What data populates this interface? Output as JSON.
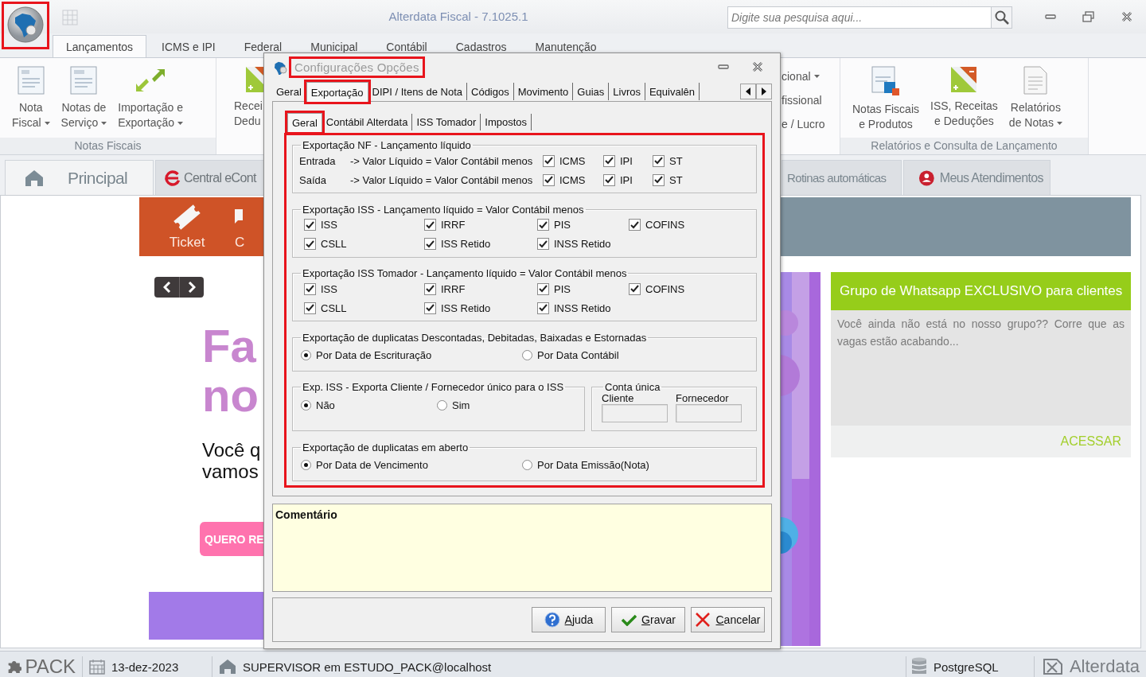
{
  "app": {
    "title": "Alterdata Fiscal - 7.1025.1",
    "logo_highlighted": true
  },
  "search": {
    "placeholder": "Digite sua pesquisa aqui..."
  },
  "ribbon_tabs": [
    {
      "label": "Lançamentos",
      "selected": true
    },
    {
      "label": "ICMS e IPI",
      "selected": false
    },
    {
      "label": "Federal",
      "selected": false
    },
    {
      "label": "Municipal",
      "selected": false
    },
    {
      "label": "Contábil",
      "selected": false
    },
    {
      "label": "Cadastros",
      "selected": false
    },
    {
      "label": "Manutenção",
      "selected": false
    }
  ],
  "ribbon_groups": [
    {
      "kind": "buttons",
      "title": "Notas Fiscais",
      "buttons": [
        {
          "lines": [
            "Nota",
            "Fiscal"
          ],
          "dropdown": true
        },
        {
          "lines": [
            "Notas de",
            "Serviço"
          ],
          "dropdown": true
        },
        {
          "lines": [
            "Importação e",
            "Exportação"
          ],
          "dropdown": true
        }
      ]
    },
    {
      "kind": "partial",
      "buttons": [
        {
          "lines": [
            "Recei",
            "Dedu"
          ]
        }
      ]
    },
    {
      "kind": "list",
      "items": [
        {
          "label": "cional",
          "dropdown": true
        },
        {
          "label": "fissional",
          "dropdown": false
        },
        {
          "label": "e / Lucro",
          "dropdown": false
        }
      ]
    },
    {
      "kind": "buttons",
      "title": "Relatórios e Consulta de Lançamento",
      "buttons": [
        {
          "lines": [
            "Notas Fiscais",
            "e Produtos"
          ],
          "dropdown": false
        },
        {
          "lines": [
            "ISS, Receitas",
            "e Deduções"
          ],
          "dropdown": false
        },
        {
          "lines": [
            "Relatórios",
            "de Notas"
          ],
          "dropdown": true
        }
      ]
    }
  ],
  "doc_tabs": [
    {
      "label": "Principal",
      "selected": true
    },
    {
      "label": "Central eCont",
      "selected": false
    },
    {
      "label": "Rotinas automáticas",
      "selected": false
    },
    {
      "label": "Meus Atendimentos",
      "selected": false
    }
  ],
  "web": {
    "shortcuts": [
      {
        "label": "Ticket"
      },
      {
        "label": "C"
      }
    ],
    "headline": [
      "Fa",
      "no"
    ],
    "subtext": [
      "Você q",
      "vamos"
    ],
    "cta": "QUERO RE",
    "card": {
      "title": "Grupo de Whatsapp EXCLUSIVO para clientes",
      "body": "Você ainda não está no nosso grupo?? Corre que as vagas estão acabando...",
      "link": "ACESSAR"
    }
  },
  "dialog": {
    "title": "Configurações Opções",
    "title_highlighted": true,
    "tabs": [
      {
        "label": "Geral",
        "selected": false,
        "highlighted": false
      },
      {
        "label": "Exportação",
        "selected": true,
        "highlighted": true
      },
      {
        "label": "DIPI / Itens de Nota",
        "selected": false,
        "highlighted": false
      },
      {
        "label": "Códigos",
        "selected": false,
        "highlighted": false
      },
      {
        "label": "Movimento",
        "selected": false,
        "highlighted": false
      },
      {
        "label": "Guias",
        "selected": false,
        "highlighted": false
      },
      {
        "label": "Livros",
        "selected": false,
        "highlighted": false
      },
      {
        "label": "Equivalên",
        "selected": false,
        "highlighted": false
      }
    ],
    "subtabs": [
      {
        "label": "Geral",
        "selected": true,
        "highlighted": true
      },
      {
        "label": "Contábil Alterdata",
        "selected": false,
        "highlighted": false
      },
      {
        "label": "ISS Tomador",
        "selected": false,
        "highlighted": false
      },
      {
        "label": "Impostos",
        "selected": false,
        "highlighted": false
      }
    ],
    "options_highlighted": true,
    "groups": [
      {
        "kind": "nf",
        "title": "Exportação NF - Lançamento líquido",
        "rows": [
          {
            "label": "Entrada",
            "formula": "-> Valor Líquido = Valor Contábil menos",
            "checks": [
              {
                "label": "ICMS",
                "checked": true
              },
              {
                "label": "IPI",
                "checked": true
              },
              {
                "label": "ST",
                "checked": true
              }
            ]
          },
          {
            "label": "Saída",
            "formula": "-> Valor Líquido = Valor Contábil menos",
            "checks": [
              {
                "label": "ICMS",
                "checked": true
              },
              {
                "label": "IPI",
                "checked": true
              },
              {
                "label": "ST",
                "checked": true
              }
            ]
          }
        ]
      },
      {
        "kind": "checks",
        "title": "Exportação ISS - Lançamento líquido = Valor Contábil menos",
        "checks": [
          {
            "label": "ISS",
            "checked": true
          },
          {
            "label": "IRRF",
            "checked": true
          },
          {
            "label": "PIS",
            "checked": true
          },
          {
            "label": "COFINS",
            "checked": true
          },
          {
            "label": "CSLL",
            "checked": true
          },
          {
            "label": "ISS Retido",
            "checked": true
          },
          {
            "label": "INSS Retido",
            "checked": true
          }
        ]
      },
      {
        "kind": "checks",
        "title": "Exportação ISS Tomador - Lançamento líquido = Valor Contábil menos",
        "checks": [
          {
            "label": "ISS",
            "checked": true
          },
          {
            "label": "IRRF",
            "checked": true
          },
          {
            "label": "PIS",
            "checked": true
          },
          {
            "label": "COFINS",
            "checked": true
          },
          {
            "label": "CSLL",
            "checked": true
          },
          {
            "label": "ISS Retido",
            "checked": true
          },
          {
            "label": "INSS Retido",
            "checked": true
          }
        ]
      },
      {
        "kind": "radios",
        "title": "Exportação de duplicatas Descontadas, Debitadas, Baixadas e Estornadas",
        "options": [
          {
            "label": "Por Data de Escrituração",
            "selected": true
          },
          {
            "label": "Por Data Contábil",
            "selected": false
          }
        ]
      },
      {
        "kind": "radios_split",
        "title": "Exp. ISS - Exporta Cliente / Fornecedor único para o ISS",
        "options": [
          {
            "label": "Não",
            "selected": true
          },
          {
            "label": "Sim",
            "selected": false
          }
        ],
        "side": {
          "title": "Conta única",
          "fields": [
            {
              "label": "Cliente"
            },
            {
              "label": "Fornecedor"
            }
          ]
        }
      },
      {
        "kind": "radios",
        "title": "Exportação de duplicatas em aberto",
        "options": [
          {
            "label": "Por Data de Vencimento",
            "selected": true
          },
          {
            "label": "Por Data Emissão(Nota)",
            "selected": false
          }
        ]
      }
    ],
    "comment_label": "Comentário",
    "buttons": [
      {
        "label": "Ajuda"
      },
      {
        "label": "Gravar"
      },
      {
        "label": "Cancelar"
      }
    ]
  },
  "status_bar": {
    "product": "PACK",
    "date": "13-dez-2023",
    "user": "SUPERVISOR em ESTUDO_PACK@localhost",
    "database": "PostgreSQL",
    "brand": "Alterdata"
  }
}
